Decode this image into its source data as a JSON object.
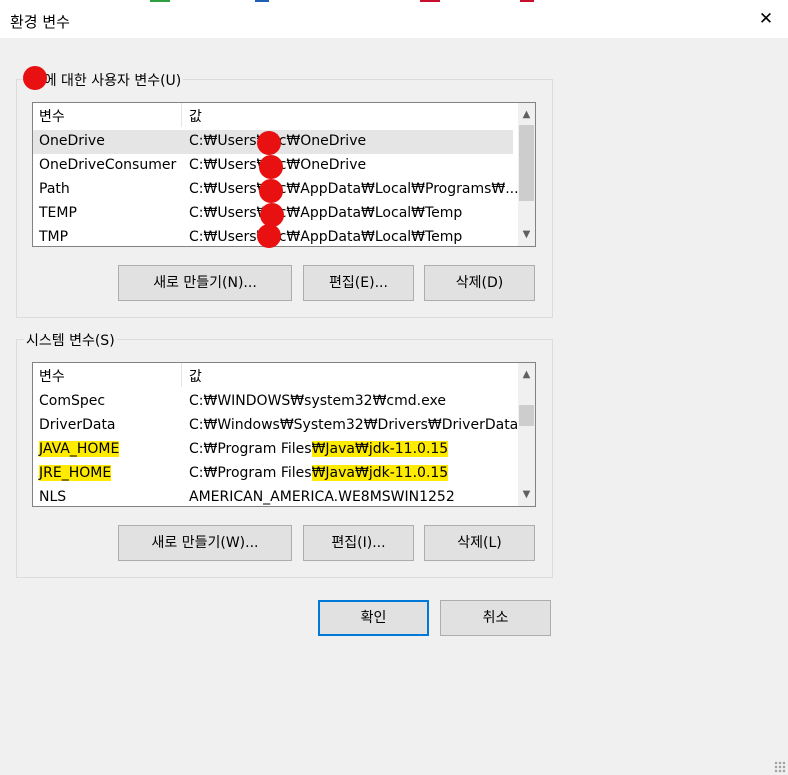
{
  "window": {
    "title": "환경 변수",
    "close_icon": "✕"
  },
  "user_section": {
    "legend": "c에 대한 사용자 변수(U)",
    "header": {
      "name": "변수",
      "value": "값"
    },
    "rows": [
      {
        "name": "OneDrive",
        "value": "C:₩Users₩     ic₩OneDrive"
      },
      {
        "name": "OneDriveConsumer",
        "value": "C:₩Users₩     ic₩OneDrive"
      },
      {
        "name": "Path",
        "value": "C:₩Users₩     ic₩AppData₩Local₩Programs₩..."
      },
      {
        "name": "TEMP",
        "value": "C:₩Users₩     ic₩AppData₩Local₩Temp"
      },
      {
        "name": "TMP",
        "value": "C:₩Users₩     ic₩AppData₩Local₩Temp"
      }
    ],
    "buttons": {
      "new": "새로 만들기(N)...",
      "edit": "편집(E)...",
      "delete": "삭제(D)"
    }
  },
  "system_section": {
    "legend": "시스템 변수(S)",
    "header": {
      "name": "변수",
      "value": "값"
    },
    "rows": [
      {
        "name": "ComSpec",
        "value": "C:₩WINDOWS₩system32₩cmd.exe"
      },
      {
        "name": "DriverData",
        "value": "C:₩Windows₩System32₩Drivers₩DriverData"
      },
      {
        "name": "JAVA_HOME",
        "value_prefix": "C:₩Program Files",
        "value_highlight": "₩Java₩jdk-11.0.15"
      },
      {
        "name": "JRE_HOME",
        "value_prefix": "C:₩Program Files",
        "value_highlight": "₩Java₩jdk-11.0.15"
      },
      {
        "name": "NLS",
        "value": "AMERICAN_AMERICA.WE8MSWIN1252"
      }
    ],
    "buttons": {
      "new": "새로 만들기(W)...",
      "edit": "편집(I)...",
      "delete": "삭제(L)"
    }
  },
  "dialog_buttons": {
    "ok": "확인",
    "cancel": "취소"
  },
  "icons": {
    "scroll_up": "▲",
    "scroll_down": "▼"
  },
  "colors": {
    "highlight": "#ffeb00",
    "redaction": "#e81010",
    "focus_border": "#0078d7"
  }
}
